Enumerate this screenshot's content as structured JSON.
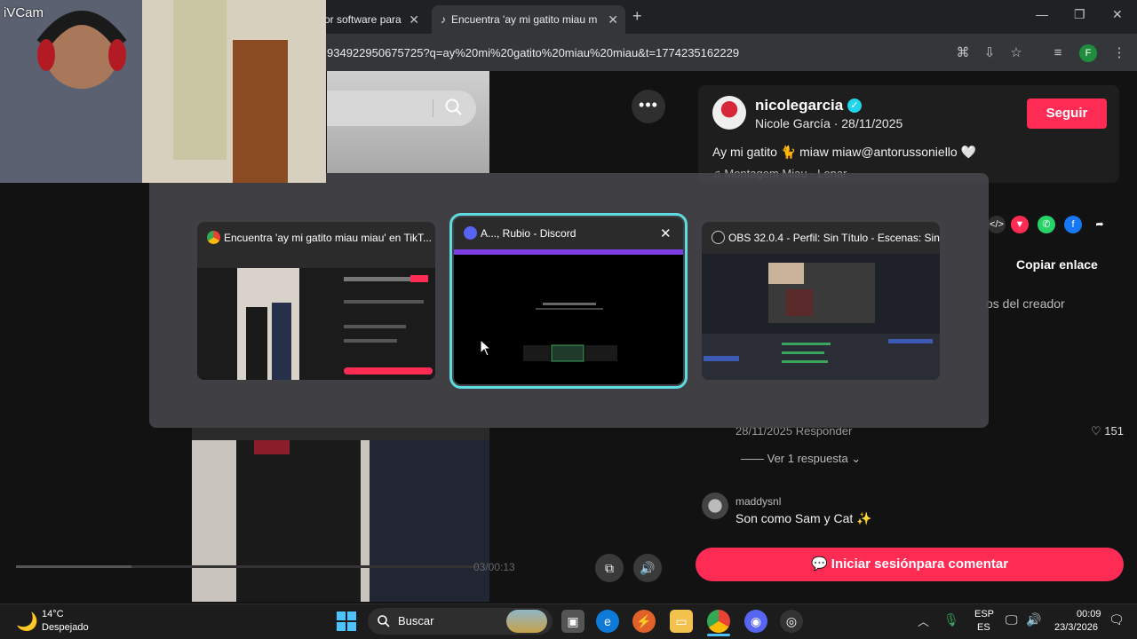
{
  "webcam": {
    "label": "iVCam"
  },
  "browser": {
    "tabs": [
      {
        "title": "or software para"
      },
      {
        "title": "Encuentra 'ay mi gatito miau m"
      }
    ],
    "url": "934922950675725?q=ay%20mi%20gatito%20miau%20miau&t=1774235162229",
    "profile_initial": "F"
  },
  "post": {
    "author_username": "nicolegarcia",
    "author_display": "Nicole García · 28/11/2025",
    "follow_label": "Seguir",
    "caption": "Ay mi gatito 🐈 miaw miaw@antorussoniello 🤍",
    "music": "♫  Montagem Miau - Lenar",
    "copy_link": "Copiar enlace",
    "creator_tab": "os del creador",
    "more_label": "•••"
  },
  "comments": {
    "first_meta": "28/11/2025    Responder",
    "first_likes": "♡ 151",
    "view_replies": "—— Ver 1 respuesta ⌄",
    "second_user": "maddysnl",
    "second_text": "Son como Sam y Cat ✨",
    "login_label": "💬 Iniciar sesiónpara comentar"
  },
  "video": {
    "timecode": "03/00:13"
  },
  "switcher": {
    "windows": [
      {
        "title": "Encuentra 'ay mi gatito miau miau' en TikT..."
      },
      {
        "title": "A..., Rubio - Discord"
      },
      {
        "title": "OBS 32.0.4 - Perfil: Sin Título - Escenas: Sin..."
      }
    ],
    "close_glyph": "✕"
  },
  "taskbar": {
    "temp": "14°C",
    "weather": "Despejado",
    "search": "Buscar",
    "lang_top": "ESP",
    "lang_bottom": "ES",
    "time": "00:09",
    "date": "23/3/2026"
  }
}
